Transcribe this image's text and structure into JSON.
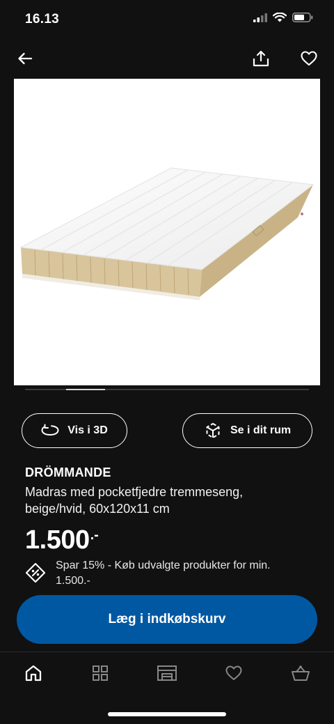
{
  "status_bar": {
    "time": "16.13"
  },
  "nav": {
    "back_icon": "arrow-left-icon",
    "share_icon": "share-icon",
    "favorite_icon": "heart-icon"
  },
  "gallery": {
    "image_alt": "mattress product photo"
  },
  "actions": {
    "view_3d_label": "Vis i 3D",
    "view_room_label": "Se i dit rum"
  },
  "product": {
    "name": "DRÖMMANDE",
    "description": "Madras med pocketfjedre tremmeseng, beige/hvid, 60x120x11 cm",
    "price": "1.500",
    "price_suffix": ".-",
    "promo": "Spar 15% - Køb udvalgte produkter for min. 1.500.-"
  },
  "cta": {
    "label": "Læg i indkøbskurv"
  },
  "tabs": [
    {
      "name": "home",
      "icon": "home-icon"
    },
    {
      "name": "categories",
      "icon": "grid-icon"
    },
    {
      "name": "stores",
      "icon": "store-icon"
    },
    {
      "name": "favorites",
      "icon": "heart-icon"
    },
    {
      "name": "basket",
      "icon": "basket-icon"
    }
  ],
  "colors": {
    "background": "#111111",
    "accent": "#0058A3",
    "mattress_top": "#ffffff",
    "mattress_side": "#d8c59c"
  }
}
